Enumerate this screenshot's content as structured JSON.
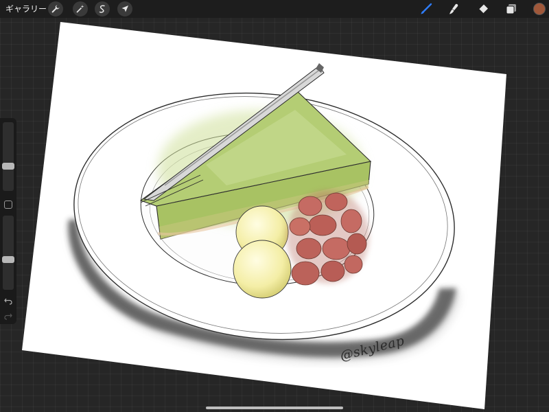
{
  "toolbar": {
    "gallery_label": "ギャラリー",
    "left_tools": [
      {
        "name": "wrench-icon",
        "label": "actions"
      },
      {
        "name": "magic-wand-icon",
        "label": "adjustments"
      },
      {
        "name": "selection-icon",
        "label": "selection"
      },
      {
        "name": "arrow-cursor-icon",
        "label": "transform"
      }
    ],
    "right_tools": [
      {
        "name": "brush-icon",
        "active": true
      },
      {
        "name": "smudge-icon",
        "active": false
      },
      {
        "name": "eraser-icon",
        "active": false
      },
      {
        "name": "layers-icon",
        "active": false
      }
    ],
    "current_color": "#a0583a"
  },
  "sidebar": {
    "brush_size_level": 0.35,
    "opacity_level": 0.4
  },
  "canvas": {
    "signature": "@skyleap"
  },
  "colors": {
    "accent": "#2f7dff",
    "matcha": "#9dbb55",
    "beans": "#b35a4e"
  }
}
